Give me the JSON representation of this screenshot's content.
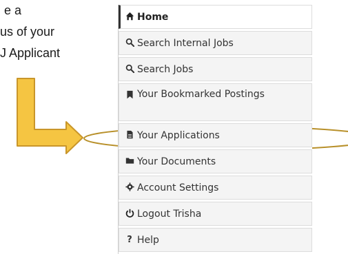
{
  "document": {
    "lines": [
      "e a",
      "us of your",
      "J Applicant"
    ]
  },
  "menu": {
    "items": [
      {
        "label": "Home",
        "icon": "home-icon"
      },
      {
        "label": "Search Internal Jobs",
        "icon": "search-icon"
      },
      {
        "label": "Search Jobs",
        "icon": "search-icon"
      },
      {
        "label": "Your Bookmarked Postings",
        "icon": "bookmark-icon"
      },
      {
        "label": "Your Applications",
        "icon": "document-icon"
      },
      {
        "label": "Your Documents",
        "icon": "folder-icon"
      },
      {
        "label": "Account Settings",
        "icon": "gear-icon"
      },
      {
        "label": "Logout Trisha",
        "icon": "power-icon"
      },
      {
        "label": "Help",
        "icon": "question-icon"
      }
    ]
  },
  "annotation": {
    "arrow_color": "#f5c542",
    "arrow_outline": "#c9962a",
    "ellipse_color": "#b8902a"
  }
}
